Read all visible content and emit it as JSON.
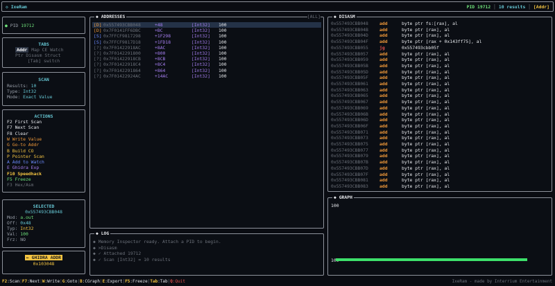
{
  "topbar": {
    "title": "◇ IxeRam",
    "pid_label": "PID",
    "pid": "19712",
    "results": "10 results",
    "mode": "[Addr]"
  },
  "pid_panel": {
    "label": "PID",
    "pid": "19712"
  },
  "tabs": {
    "title": "TABS",
    "items": [
      "Addr",
      "Map",
      "CE",
      "Watch",
      "Ptr",
      "Disasm",
      "Struct"
    ],
    "hint": "[Tab] switch"
  },
  "scan": {
    "title": "SCAN",
    "results_label": "Results:",
    "results": "10",
    "type_label": "Type:",
    "type": "Int32",
    "mode_label": "Mode:",
    "mode": "Exact Value"
  },
  "actions": {
    "title": "ACTIONS",
    "items": [
      {
        "key": "F2",
        "label": "First Scan"
      },
      {
        "key": "F7",
        "label": "Next Scan"
      },
      {
        "key": "F8",
        "label": "Clear"
      },
      {
        "key": "W",
        "label": "Write Value"
      },
      {
        "key": "G",
        "label": "Go-to Addr"
      },
      {
        "key": "B",
        "label": "Build CO"
      },
      {
        "key": "P",
        "label": "Pointer Scan"
      },
      {
        "key": "A",
        "label": "Add to Watch"
      },
      {
        "key": "E",
        "label": "Ghidra Exp"
      },
      {
        "key": "F10",
        "label": "Speedhack"
      },
      {
        "key": "F5",
        "label": "Freeze"
      },
      {
        "key": "F3",
        "label": "Hex/Asm"
      }
    ]
  },
  "selected": {
    "title": "SELECTED",
    "addr": "0x557493CBB048",
    "mod_label": "Mod:",
    "mod": "a.out",
    "off_label": "Off:",
    "off": "0x48",
    "typ_label": "Typ:",
    "typ": "Int32",
    "val_label": "Val:",
    "val": "100",
    "frz_label": "Frz:",
    "frz": "NO"
  },
  "ghidra": {
    "label": "← GHIDRA ADDR",
    "addr": "0x103048"
  },
  "addresses": {
    "title": "◆ ADDRESSES",
    "right": "[ALL]",
    "rows": [
      {
        "region": "[D]",
        "addr": "0x557493CBB048",
        "off": "+48",
        "type": "[Int32]",
        "val": "100"
      },
      {
        "region": "[D]",
        "addr": "0x7F0141FF6DBC",
        "off": "+BC",
        "type": "[Int32]",
        "val": "100"
      },
      {
        "region": "[S]",
        "addr": "0x7FFCF9817298",
        "off": "+1F298",
        "type": "[Int32]",
        "val": "100"
      },
      {
        "region": "[S]",
        "addr": "0x7FFCF9817D18",
        "off": "+1FD18",
        "type": "[Int32]",
        "val": "100"
      },
      {
        "region": "[?]",
        "addr": "0x7F01422918AC",
        "off": "+8AC",
        "type": "[Int32]",
        "val": "100"
      },
      {
        "region": "[?]",
        "addr": "0x7F0142291800",
        "off": "+800",
        "type": "[Int32]",
        "val": "100"
      },
      {
        "region": "[?]",
        "addr": "0x7F01422918CB",
        "off": "+8CB",
        "type": "[Int32]",
        "val": "100"
      },
      {
        "region": "[?]",
        "addr": "0x7F01422918C4",
        "off": "+8C4",
        "type": "[Int32]",
        "val": "100"
      },
      {
        "region": "[?]",
        "addr": "0x7F0142291864",
        "off": "+864",
        "type": "[Int32]",
        "val": "100"
      },
      {
        "region": "[?]",
        "addr": "0x7F01422924AC",
        "off": "+14AC",
        "type": "[Int32]",
        "val": "100"
      }
    ]
  },
  "log": {
    "title": "◆ LOG",
    "lines": [
      "◆ Memory Inspector ready. Attach a PID to begin.",
      "◆ >Disasm",
      "◆ ✓ Attached 19712",
      "◆ ✓ Scan [Int32] = 10 results"
    ]
  },
  "disasm": {
    "title": "◆ DISASM",
    "rows": [
      {
        "a": "0x557493CBB048",
        "m": "add",
        "o": "byte ptr fs:[rax], al"
      },
      {
        "a": "0x557493CBB04B",
        "m": "add",
        "o": "byte ptr [rax], al"
      },
      {
        "a": "0x557493CBB04D",
        "m": "add",
        "o": "byte ptr [rax], al"
      },
      {
        "a": "0x557493CBB04F",
        "m": "add",
        "o": "byte ptr [rax + 0x143ff75], al"
      },
      {
        "a": "0x557493CBB055",
        "m": "jg",
        "o": "0x557493cbb05f"
      },
      {
        "a": "0x557493CBB057",
        "m": "add",
        "o": "byte ptr [rax], al"
      },
      {
        "a": "0x557493CBB059",
        "m": "add",
        "o": "byte ptr [rax], al"
      },
      {
        "a": "0x557493CBB05B",
        "m": "add",
        "o": "byte ptr [rax], al"
      },
      {
        "a": "0x557493CBB05D",
        "m": "add",
        "o": "byte ptr [rax], al"
      },
      {
        "a": "0x557493CBB05F",
        "m": "add",
        "o": "byte ptr [rax], al"
      },
      {
        "a": "0x557493CBB061",
        "m": "add",
        "o": "byte ptr [rax], al"
      },
      {
        "a": "0x557493CBB063",
        "m": "add",
        "o": "byte ptr [rax], al"
      },
      {
        "a": "0x557493CBB065",
        "m": "add",
        "o": "byte ptr [rax], al"
      },
      {
        "a": "0x557493CBB067",
        "m": "add",
        "o": "byte ptr [rax], al"
      },
      {
        "a": "0x557493CBB069",
        "m": "add",
        "o": "byte ptr [rax], al"
      },
      {
        "a": "0x557493CBB06B",
        "m": "add",
        "o": "byte ptr [rax], al"
      },
      {
        "a": "0x557493CBB06D",
        "m": "add",
        "o": "byte ptr [rax], al"
      },
      {
        "a": "0x557493CBB06F",
        "m": "add",
        "o": "byte ptr [rax], al"
      },
      {
        "a": "0x557493CBB071",
        "m": "add",
        "o": "byte ptr [rax], al"
      },
      {
        "a": "0x557493CBB073",
        "m": "add",
        "o": "byte ptr [rax], al"
      },
      {
        "a": "0x557493CBB075",
        "m": "add",
        "o": "byte ptr [rax], al"
      },
      {
        "a": "0x557493CBB077",
        "m": "add",
        "o": "byte ptr [rax], al"
      },
      {
        "a": "0x557493CBB079",
        "m": "add",
        "o": "byte ptr [rax], al"
      },
      {
        "a": "0x557493CBB07B",
        "m": "add",
        "o": "byte ptr [rax], al"
      },
      {
        "a": "0x557493CBB07D",
        "m": "add",
        "o": "byte ptr [rax], al"
      },
      {
        "a": "0x557493CBB07F",
        "m": "add",
        "o": "byte ptr [rax], al"
      },
      {
        "a": "0x557493CBB081",
        "m": "add",
        "o": "byte ptr [rax], al"
      },
      {
        "a": "0x557493CBB083",
        "m": "add",
        "o": "byte ptr [rax], al"
      }
    ]
  },
  "graph": {
    "title": "◆ GRAPH",
    "top_label": "100",
    "bottom_label": "100"
  },
  "statusbar": {
    "keys": [
      {
        "k": "F2",
        "l": ":Scan"
      },
      {
        "k": "F7",
        "l": ":Next"
      },
      {
        "k": "W",
        "l": ":Write"
      },
      {
        "k": "G",
        "l": ":Goto"
      },
      {
        "k": "B",
        "l": ":CGraph"
      },
      {
        "k": "E",
        "l": ":Export"
      },
      {
        "k": "F5",
        "l": ":Freeze"
      },
      {
        "k": "Tab",
        "l": ":Tab"
      },
      {
        "k": "Q",
        "l": ":Quit"
      }
    ],
    "right": "IxeRam - made by Interrium Entertainment"
  },
  "colors": {
    "accent": "#f5c542",
    "green": "#6ee07a",
    "selection": "#243247"
  }
}
